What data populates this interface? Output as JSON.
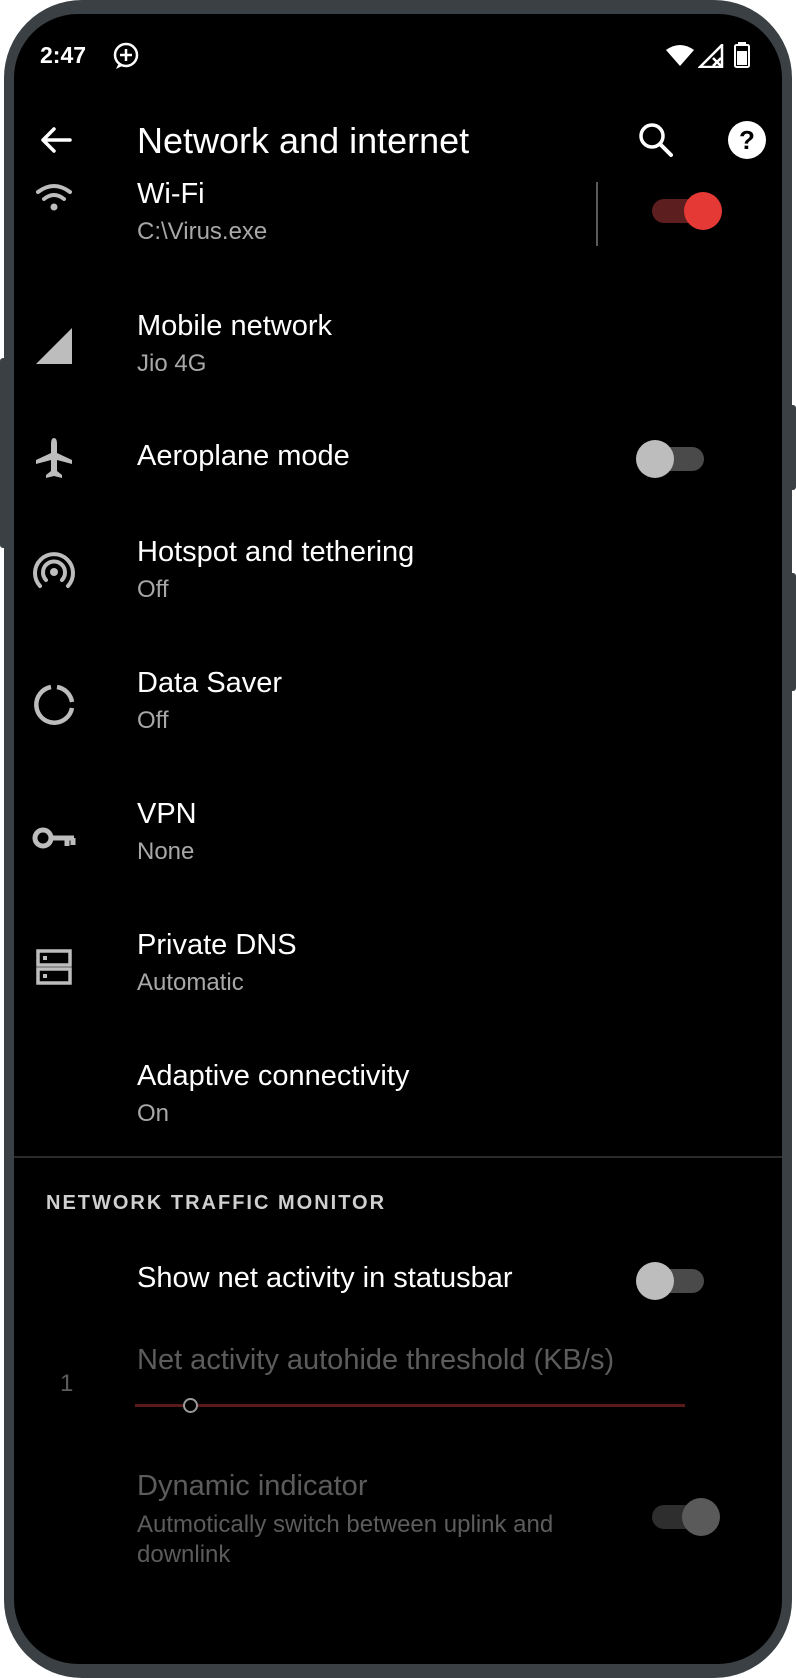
{
  "status_bar": {
    "time": "2:47",
    "icons": [
      "notification-plus-icon",
      "wifi-icon",
      "signal-off-icon",
      "battery-icon"
    ]
  },
  "app_bar": {
    "title": "Network and internet",
    "back_icon": "arrow-left-icon",
    "search_icon": "search-icon",
    "help_icon": "help-circle-icon"
  },
  "settings": {
    "wifi": {
      "title": "Wi-Fi",
      "subtitle": "C:\\Virus.exe",
      "enabled": true
    },
    "mobile": {
      "title": "Mobile network",
      "subtitle": "Jio 4G"
    },
    "aeroplane": {
      "title": "Aeroplane mode",
      "enabled": false
    },
    "hotspot": {
      "title": "Hotspot and tethering",
      "subtitle": "Off"
    },
    "datasaver": {
      "title": "Data Saver",
      "subtitle": "Off"
    },
    "vpn": {
      "title": "VPN",
      "subtitle": "None"
    },
    "dns": {
      "title": "Private DNS",
      "subtitle": "Automatic"
    },
    "adaptive": {
      "title": "Adaptive connectivity",
      "subtitle": "On"
    }
  },
  "traffic": {
    "section_header": "NETWORK TRAFFIC MONITOR",
    "show_activity": {
      "title": "Show net activity in statusbar",
      "enabled": false
    },
    "threshold": {
      "title": "Net activity autohide threshold (KB/s)",
      "value": "1",
      "slider_fraction": 0.1
    },
    "dynamic": {
      "title": "Dynamic indicator",
      "subtitle": "Autmotically switch between uplink and downlink",
      "enabled": true
    }
  },
  "colors": {
    "accent": "#e53935",
    "background": "#000000",
    "secondary_text": "#a8a8a8"
  }
}
